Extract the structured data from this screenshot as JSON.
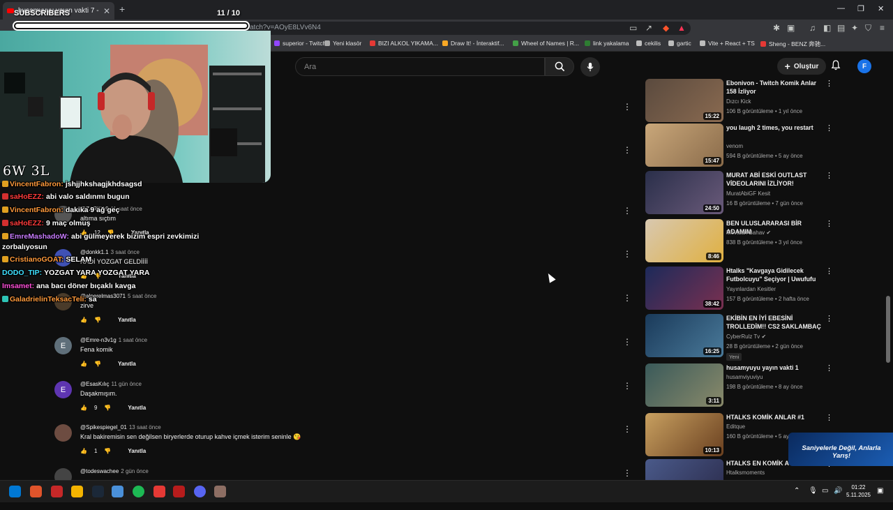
{
  "browser": {
    "tab_title": "husamyuyu yayın vakti 7 - YouTube",
    "url_suffix": "atch?v=AOyE8LVv6N4",
    "bookmarks": [
      {
        "label": "superior - Twitch",
        "color": "#9146ff"
      },
      {
        "label": "Yeni klasör",
        "color": "#aaaaaa"
      },
      {
        "label": "BIZI ALKOL YIKAMA...",
        "color": "#e53935"
      },
      {
        "label": "Draw It! - İnteraktif...",
        "color": "#f9a825"
      },
      {
        "label": "Wheel of Names | R...",
        "color": "#43a047"
      },
      {
        "label": "link yakalama",
        "color": "#2e7d32"
      },
      {
        "label": "cekilis",
        "color": "#bdbdbd"
      },
      {
        "label": "gartic",
        "color": "#bdbdbd"
      },
      {
        "label": "Vite + React + TS",
        "color": "#bdbdbd"
      },
      {
        "label": "Sheng - BENZ 奔驰...",
        "color": "#e53935"
      }
    ]
  },
  "header": {
    "search_placeholder": "Ara",
    "create_label": "Oluştur",
    "avatar_letter": "F"
  },
  "comments": [
    {
      "user": "@ZARK-s9",
      "time": "11 saat önce",
      "text": "altıma sıçtım",
      "likes": "12",
      "reply": "Yanıtla",
      "avatar_color": "#555555",
      "letter": ""
    },
    {
      "user": "@donkk1.1",
      "time": "3 saat önce",
      "text": "RADİ YOZGAT GELDİİİİ",
      "likes": "",
      "reply": "Yanıtla",
      "avatar_color": "#3f51b5",
      "letter": ""
    },
    {
      "user": "@alperelmas3071",
      "time": "5 saat önce",
      "text": "zirve",
      "likes": "",
      "reply": "Yanıtla",
      "avatar_color": "#4a3b2a",
      "letter": ""
    },
    {
      "user": "@Emre-n3v1g",
      "time": "1 saat önce",
      "text": "Fena komik",
      "likes": "",
      "reply": "Yanıtla",
      "avatar_color": "#5f6f7a",
      "letter": "E"
    },
    {
      "user": "@EsasKılıç",
      "time": "11 gün önce",
      "text": "Daşakmışım.",
      "likes": "9",
      "reply": "Yanıtla",
      "avatar_color": "#5e35b1",
      "letter": "E"
    },
    {
      "user": "@Spikespiegel_01",
      "time": "13 saat önce",
      "text": "Kral bakiremisin sen değilsen biryerlerde oturup kahve içmek isterim seninle 😘",
      "likes": "1",
      "reply": "Yanıtla",
      "avatar_color": "#6d4c41",
      "letter": ""
    },
    {
      "user": "@todeswachee",
      "time": "2 gün önce",
      "text": "",
      "likes": "",
      "reply": "",
      "avatar_color": "#444444",
      "letter": ""
    }
  ],
  "sidebar": [
    {
      "title": "Ebonivon - Twitch Komik Anlar 158 İzliyor",
      "channel": "Dızcı Kick",
      "meta": "106 B görüntüleme • 1 yıl önce",
      "duration": "15:22",
      "c1": "#5a4a3e",
      "c2": "#8a6a50",
      "verified": false,
      "badge": ""
    },
    {
      "title": "you laugh 2 times, you restart",
      "channel": "venom",
      "meta": "594 B görüntüleme • 5 ay önce",
      "duration": "15:47",
      "c1": "#c9a77a",
      "c2": "#8a6b4a",
      "verified": false,
      "badge": ""
    },
    {
      "title": "MURAT ABİ ESKİ OUTLAST VİDEOLARINI İZLİYOR!",
      "channel": "MuratAbiGF Kesit",
      "meta": "16 B görüntüleme • 7 gün önce",
      "duration": "24:50",
      "c1": "#2a2f4a",
      "c2": "#6a5a7a",
      "verified": false,
      "badge": ""
    },
    {
      "title": "BEN ULUSLARARASI BİR ADAMIM",
      "channel": "Mevtcan Bahav",
      "meta": "838 B görüntüleme • 3 yıl önce",
      "duration": "8:46",
      "c1": "#d8c8b0",
      "c2": "#e0b040",
      "verified": true,
      "badge": ""
    },
    {
      "title": "Htalks \"Kavgaya Gidilecek Futbolcuyu\" Seçiyor | Uwufufu",
      "channel": "Yayınlardan Kesitler",
      "meta": "157 B görüntüleme • 2 hafta önce",
      "duration": "38:42",
      "c1": "#1c2a5a",
      "c2": "#7a3050",
      "verified": false,
      "badge": ""
    },
    {
      "title": "EKİBİN EN İYİ EBESİNİ TROLLEDİM!! CS2 SAKLAMBAÇ",
      "channel": "CyberRulz Tv",
      "meta": "28 B görüntüleme • 2 gün önce",
      "duration": "16:25",
      "c1": "#1a3a5a",
      "c2": "#4a7a9a",
      "verified": true,
      "badge": "Yeni"
    },
    {
      "title": "husamyuyu yayın vakti 1",
      "channel": "husamviyuviyu",
      "meta": "198 B görüntüleme • 8 ay önce",
      "duration": "3:11",
      "c1": "#3a5a5a",
      "c2": "#8a8a6a",
      "verified": false,
      "badge": ""
    },
    {
      "title": "HTALKS KOMİK ANLAR #1",
      "channel": "Editque",
      "meta": "160 B görüntüleme • 5 ay önce",
      "duration": "10:13",
      "c1": "#c8a060",
      "c2": "#6a4020",
      "verified": false,
      "badge": ""
    },
    {
      "title": "HTALKS EN KOMİK A",
      "channel": "Htalksmoments",
      "meta": "",
      "duration": "",
      "c1": "#4a5a8a",
      "c2": "#2a2a4a",
      "verified": false,
      "badge": ""
    }
  ],
  "overlay": {
    "subs_label": "SUBSCRIBERS",
    "subs_count": "11  / 10",
    "subs_progress": 1.0,
    "wl": "6W 3L"
  },
  "chat": [
    {
      "user": "VincentFabron:",
      "msg": "jshjjhkshagjkhdsagsd",
      "color": "#ff9a3c",
      "badge": "#e0a020"
    },
    {
      "user": "saHoEZZ:",
      "msg": "abi valo saldınmı bugun",
      "color": "#ff3b3b",
      "badge": "#d32f2f"
    },
    {
      "user": "VincentFabron:",
      "msg": "dakika 9 ağ geç",
      "color": "#ff9a3c",
      "badge": "#e0a020"
    },
    {
      "user": "saHoEZZ:",
      "msg": "9 maç olmuş",
      "color": "#ff3b3b",
      "badge": "#d32f2f"
    },
    {
      "user": "EmreMashadoW:",
      "msg": "abi gülmeyerek bizim espri zevkimizi",
      "color": "#c87cff",
      "badge": "#e0a020"
    },
    {
      "user": "",
      "msg": "zorbalıyosun",
      "color": "#ffffff",
      "badge": ""
    },
    {
      "user": "CristianoGOAT:",
      "msg": "SELAM",
      "color": "#ff9a3c",
      "badge": "#e0a020"
    },
    {
      "user": "DODO_TIP:",
      "msg": "YOZGAT YARA YOZGAT YARA",
      "color": "#3fe0ff",
      "badge": ""
    },
    {
      "user": "Imsamet:",
      "msg": "ana bacı döner bıçaklı kavga",
      "color": "#ff4fd8",
      "badge": ""
    },
    {
      "user": "GaladrielinTeksacTeli:",
      "msg": "sa",
      "color": "#ff9a3c",
      "badge": "#2ec4b6"
    }
  ],
  "ad": {
    "text": "Saniyelerle Değil, Anlarla Yarış!"
  },
  "taskbar": {
    "time": "01:22",
    "date": "5.11.2025",
    "apps": [
      "#0078d4",
      "#e0542b",
      "#c62828",
      "#f4b400",
      "#1b2838",
      "#4a90d9",
      "#1db954",
      "#e53935",
      "#b71c1c",
      "#5865f2",
      "#8d6e63"
    ]
  }
}
